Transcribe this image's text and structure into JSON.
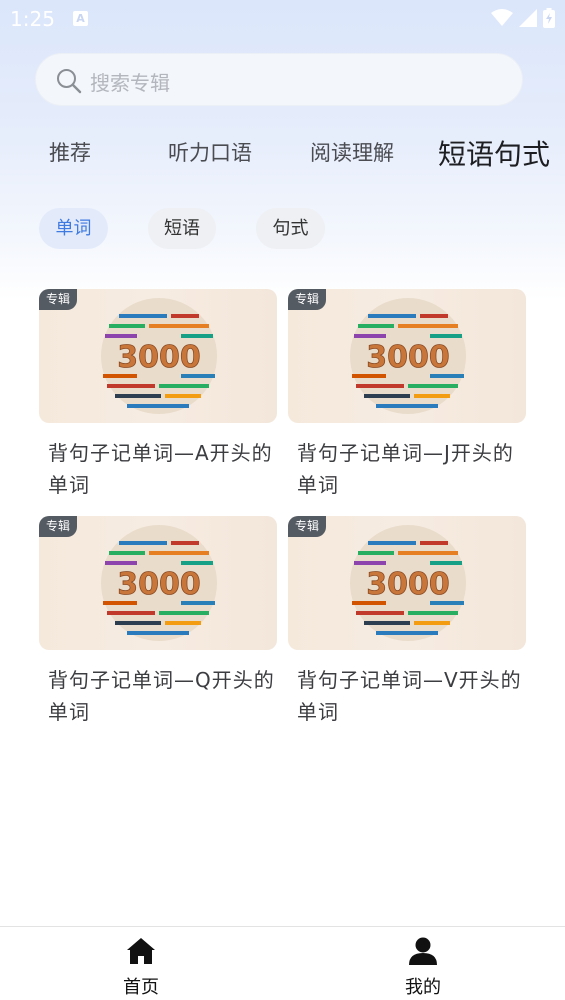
{
  "status_bar": {
    "time": "1:25",
    "notification_icon": "a-icon",
    "wifi_icon": "wifi-icon",
    "signal_icon": "signal-icon",
    "battery_icon": "battery-icon"
  },
  "search": {
    "placeholder": "搜索专辑",
    "icon": "search-icon"
  },
  "tabs": [
    {
      "label": "推荐",
      "active": false
    },
    {
      "label": "听力口语",
      "active": false
    },
    {
      "label": "阅读理解",
      "active": false
    },
    {
      "label": "短语句式",
      "active": true
    }
  ],
  "chips": [
    {
      "label": "单词",
      "active": true
    },
    {
      "label": "短语",
      "active": false
    },
    {
      "label": "句式",
      "active": false
    }
  ],
  "cards": [
    {
      "badge": "专辑",
      "title": "背句子记单词—A开头的单词",
      "image_text": "3000"
    },
    {
      "badge": "专辑",
      "title": "背句子记单词—J开头的单词",
      "image_text": "3000"
    },
    {
      "badge": "专辑",
      "title": "背句子记单词—Q开头的单词",
      "image_text": "3000"
    },
    {
      "badge": "专辑",
      "title": "背句子记单词—V开头的单词",
      "image_text": "3000"
    }
  ],
  "bottom_nav": [
    {
      "label": "首页",
      "icon": "home-icon"
    },
    {
      "label": "我的",
      "icon": "profile-icon"
    }
  ],
  "colors": {
    "accent": "#3f7ae0",
    "chip_active_bg": "#e3ebfb",
    "header_gradient_top": "#dbe6fb"
  }
}
